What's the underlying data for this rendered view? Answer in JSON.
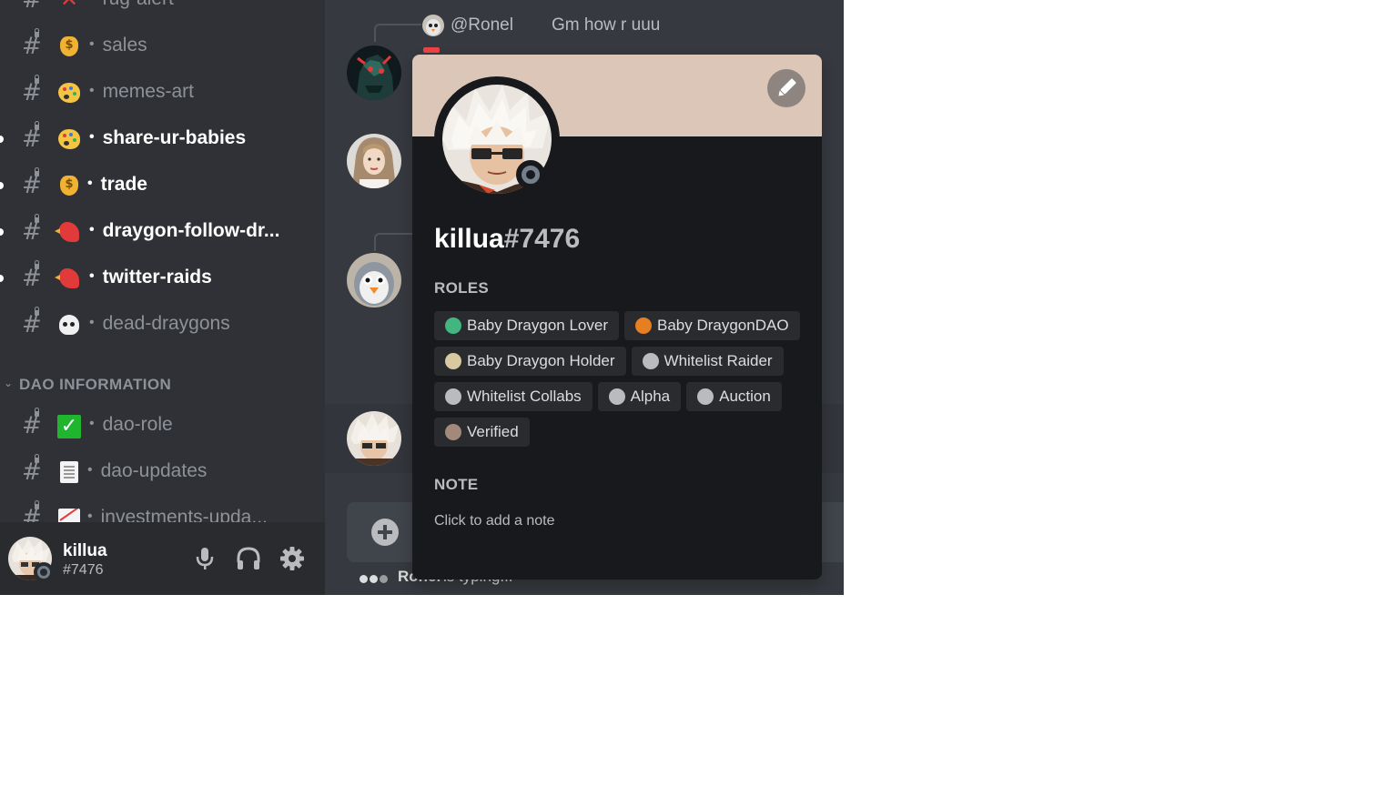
{
  "sidebar": {
    "channels": [
      {
        "emoji": "x",
        "name": "rug-alert",
        "bold": false,
        "unread": false
      },
      {
        "emoji": "money-bag",
        "name": "sales",
        "bold": false,
        "unread": false
      },
      {
        "emoji": "palette",
        "name": "memes-art",
        "bold": false,
        "unread": false
      },
      {
        "emoji": "palette",
        "name": "share-ur-babies",
        "bold": true,
        "unread": true
      },
      {
        "emoji": "money-bag",
        "name": "trade",
        "bold": true,
        "unread": true
      },
      {
        "emoji": "bird",
        "name": "draygon-follow-dr...",
        "bold": true,
        "unread": true
      },
      {
        "emoji": "bird",
        "name": "twitter-raids",
        "bold": true,
        "unread": true
      },
      {
        "emoji": "skull",
        "name": "dead-draygons",
        "bold": false,
        "unread": false
      },
      {
        "emoji": "check",
        "name": "dao-role",
        "bold": false,
        "unread": false
      },
      {
        "emoji": "page",
        "name": "dao-updates",
        "bold": false,
        "unread": false
      },
      {
        "emoji": "chart",
        "name": "investments-upda...",
        "bold": false,
        "unread": false
      }
    ],
    "category": "DAO INFORMATION"
  },
  "user_panel": {
    "username": "killua",
    "tag": "#7476",
    "icons": [
      "microphone-icon",
      "headphones-icon",
      "gear-icon"
    ]
  },
  "chat": {
    "reply": {
      "author": "@Ronel",
      "text": "Gm how r uuu"
    },
    "typing": {
      "author": "Ronel",
      "text": "is typing..."
    }
  },
  "profile": {
    "username": "killua",
    "discriminator": "#7476",
    "roles_heading": "ROLES",
    "roles": [
      {
        "name": "Baby Draygon Lover",
        "color": "#43b581"
      },
      {
        "name": "Baby DraygonDAO",
        "color": "#e67e22"
      },
      {
        "name": "Baby Draygon Holder",
        "color": "#d8c9a0"
      },
      {
        "name": "Whitelist Raider",
        "color": "#b9bbbe"
      },
      {
        "name": "Whitelist Collabs",
        "color": "#b9bbbe"
      },
      {
        "name": "Alpha",
        "color": "#b9bbbe"
      },
      {
        "name": "Auction",
        "color": "#b9bbbe"
      },
      {
        "name": "Verified",
        "color": "#a3887c"
      }
    ],
    "note_heading": "NOTE",
    "note_placeholder": "Click to add a note",
    "banner_color": "#dcc6b8"
  },
  "colors": {
    "sidebar_bg": "#2f3136",
    "chat_bg": "#36393f",
    "popout_bg": "#18191c",
    "status_offline": "#747f8d"
  }
}
